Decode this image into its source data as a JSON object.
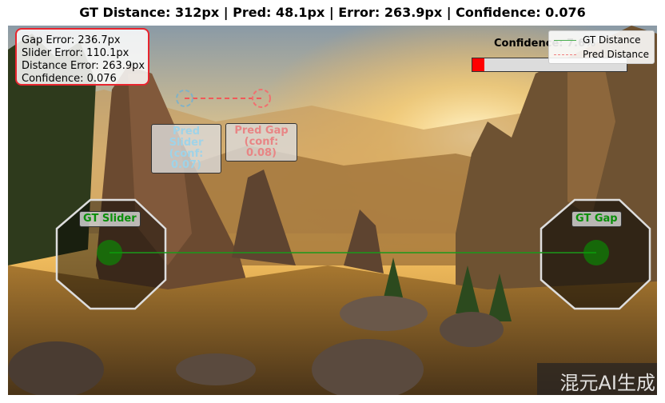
{
  "header": {
    "title": "GT Distance: 312px | Pred: 48.1px | Error: 263.9px | Confidence: 0.076"
  },
  "metrics": {
    "gap_error": "Gap Error: 236.7px",
    "slider_error": "Slider Error: 110.1px",
    "distance_error": "Distance Error: 263.9px",
    "confidence": "Confidence: 0.076"
  },
  "markers": {
    "gt_slider": "GT Slider",
    "gt_gap": "GT Gap",
    "pred_slider_line1": "Pred Slider",
    "pred_slider_line2": "(conf: 0.07)",
    "pred_gap_line1": "Pred Gap",
    "pred_gap_line2": "(conf: 0.08)"
  },
  "confidence_meter": {
    "label": "Confidence: 7.6%",
    "value": 0.076
  },
  "legend": {
    "items": [
      {
        "label": "GT Distance",
        "color": "#4caf50",
        "style": "solid"
      },
      {
        "label": "Pred Distance",
        "color": "#f08080",
        "style": "dashed"
      }
    ]
  },
  "watermark": "混元AI生成",
  "colors": {
    "gt": "#00aa00",
    "pred_slider": "#7fb2c8",
    "pred_gap": "#f07070",
    "alert": "#e8252e"
  }
}
